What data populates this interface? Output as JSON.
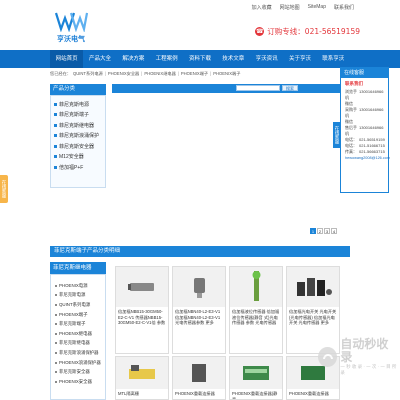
{
  "header": {
    "logo_text": "亨沃电气",
    "top_links": [
      "加入收藏",
      "网站地图",
      "SiteMap",
      "联系我们"
    ],
    "hotline": "订购专线：021-56519159"
  },
  "nav": {
    "items": [
      "网站首页",
      "产品大全",
      "解决方案",
      "工程案例",
      "资料下载",
      "技术文章",
      "亨沃资讯",
      "关于亨沃",
      "联系亨沃"
    ],
    "active": 0
  },
  "breadcrumb": [
    "您已经在：",
    "QUINT系列电源",
    "PHOENIX安全器",
    "PHOENIX继电器",
    "PHOENIX端子",
    "PHOENIX端子"
  ],
  "sidebar": {
    "title": "产品分类",
    "items": [
      "菲尼克斯电源",
      "菲尼克斯端子",
      "菲尼克斯继电器",
      "菲尼克斯浪涌保护",
      "菲尼克斯安全器",
      "M12安全器",
      "倍加福P+F"
    ]
  },
  "search": {
    "button": "搜索"
  },
  "pager": [
    "1",
    "2",
    "3",
    "4"
  ],
  "customer_service": {
    "head": "在线客服",
    "title": "联系我们",
    "rows": [
      {
        "k": "浏览手机",
        "v": "13001646966"
      },
      {
        "k": "微信",
        "v": ""
      },
      {
        "k": "采购手机",
        "v": "13001646966"
      },
      {
        "k": "微信",
        "v": ""
      },
      {
        "k": "售后手机",
        "v": "13001646966"
      },
      {
        "k": "电话：",
        "v": "021-56519159"
      },
      {
        "k": "电话：",
        "v": "021-51666715"
      },
      {
        "k": "传真：",
        "v": "021-56663715"
      }
    ],
    "email": "hewowang2008@126.com",
    "tab": "在线客服"
  },
  "left_float": "在线客服",
  "section_title": "菲尼克斯端子产品分类明细",
  "brand": {
    "title": "菲尼克斯继电器",
    "items": [
      "PHOENIX电源",
      "菲尼克斯电源",
      "QUINT系列电源",
      "PHOENIX端子",
      "菲尼克斯端子",
      "PHOENIX继电器",
      "菲尼克斯继电器",
      "菲尼克斯浪涌保护器",
      "PHOENIX浪涌保护器",
      "菲尼克斯安全器",
      "PHOENIX安全器"
    ]
  },
  "cards": [
    {
      "caption": "倍加福NBB15-30GM50-E2-C-V1 传感器NBB15-30GM50-E2-C-V1倍 参数"
    },
    {
      "caption": "倍加福NBN40-L2-E3-V1 倍加福NBN40-L2-E3-V1 光电传感器参数 更多"
    },
    {
      "caption": "倍加福液位传感器 倍加福液位传感器(静音 式)光电传感器 参数 光电传感器"
    },
    {
      "caption": "倍加福光电开关 光电开关(光电传感器) 倍加福光电开关 光电传感器 更多"
    },
    {
      "caption": "MTL隔离栅"
    },
    {
      "caption": "PHOENIX重载连接器"
    },
    {
      "caption": "PHOENIX重载连接器(静音"
    },
    {
      "caption": "PHOENIX重载连接器"
    }
  ],
  "watermark": {
    "title": "自动秒收录",
    "sub": "一 秒 收 录 · 一 次 · 一 目 所 录"
  },
  "colors": {
    "brand_blue": "#1b84d8",
    "nav_blue": "#0f6fc6",
    "hotline_red": "#e3353a",
    "float_orange": "#f7b54a"
  },
  "icons": [
    "logo-icon",
    "phone-icon"
  ]
}
